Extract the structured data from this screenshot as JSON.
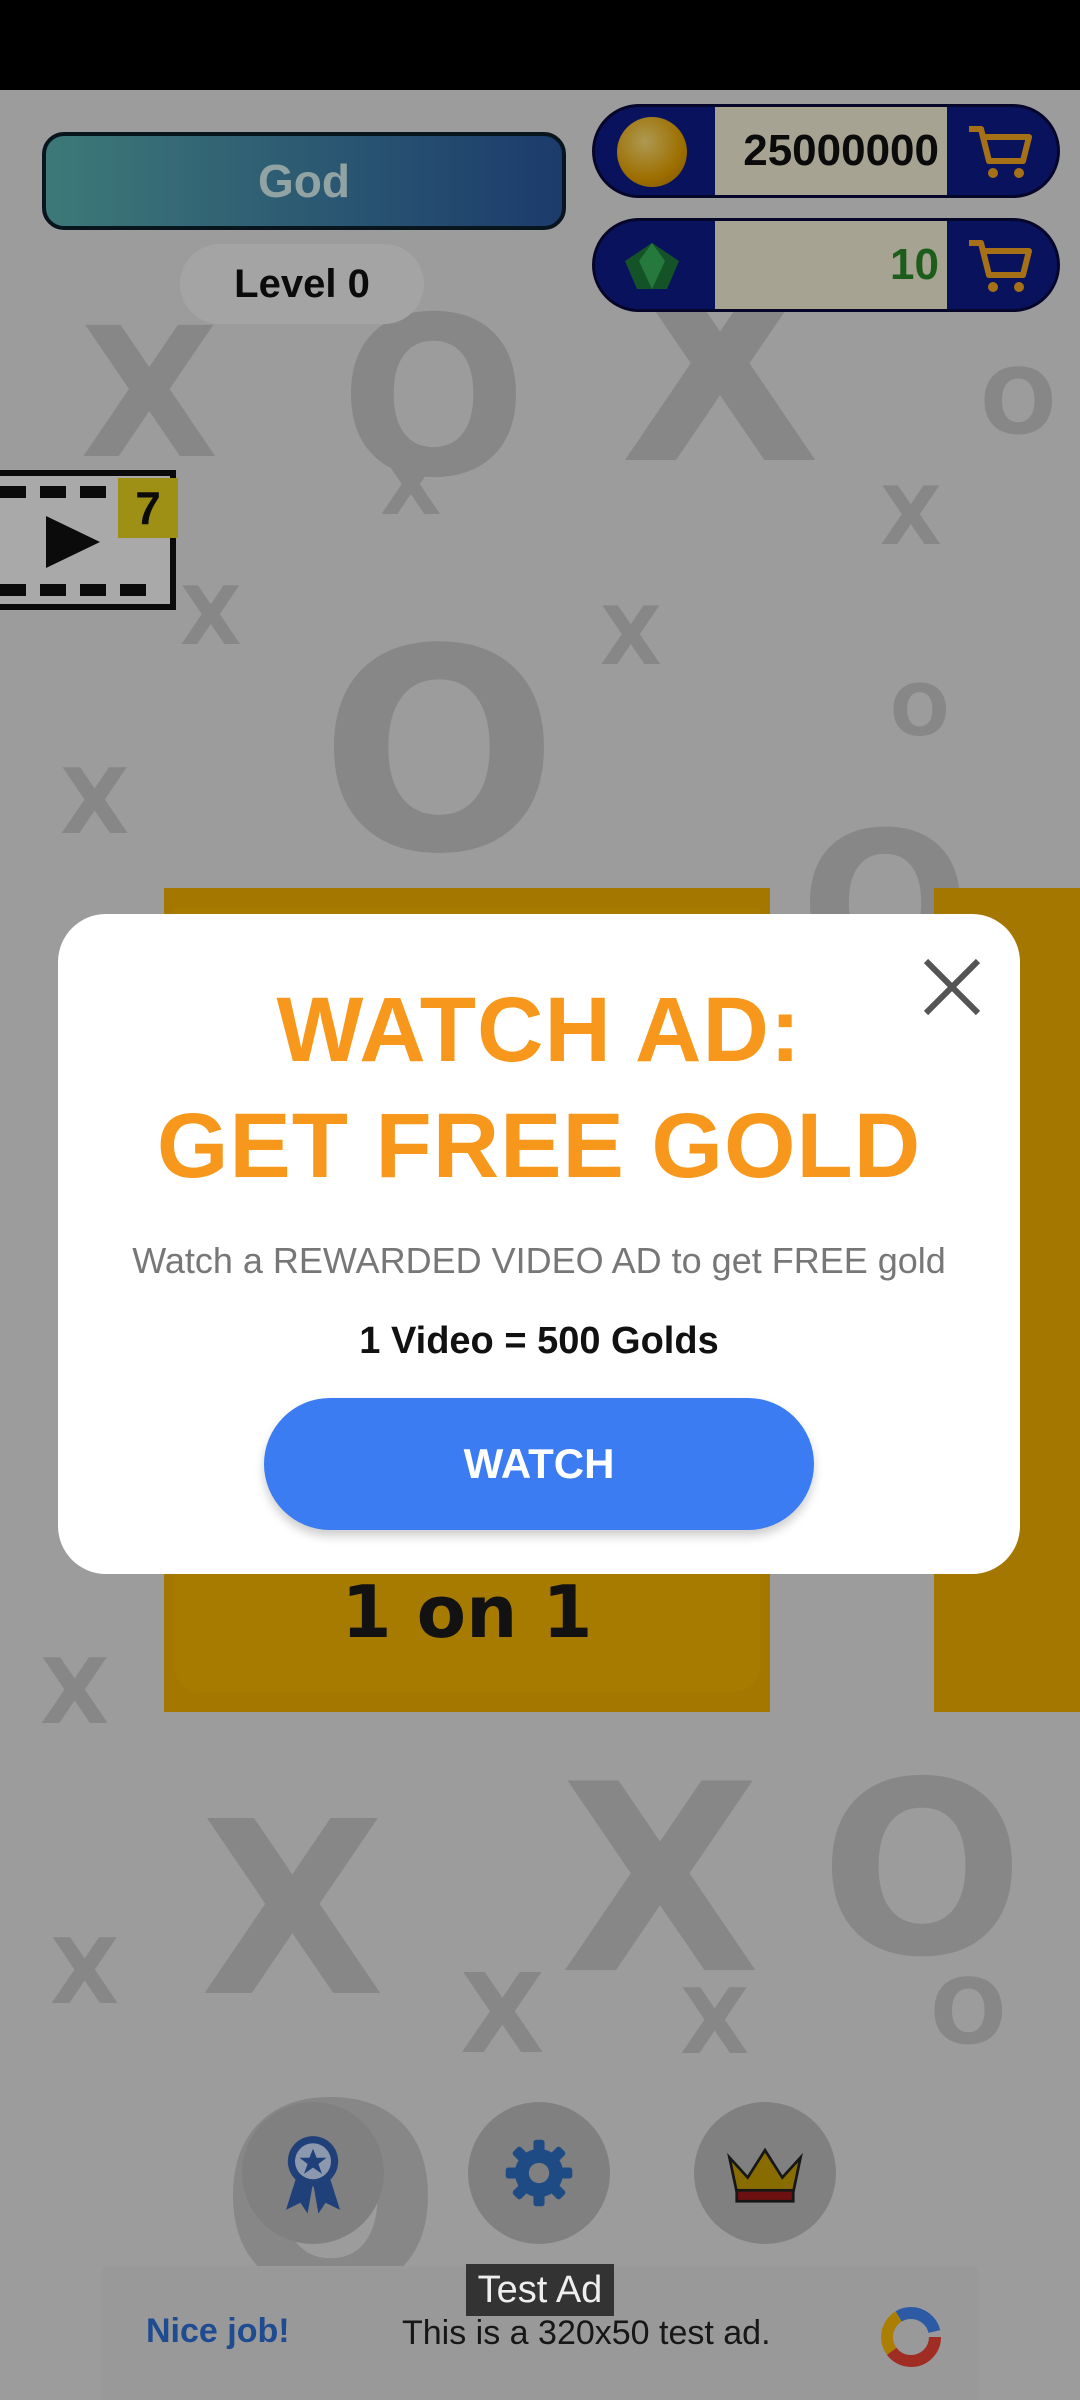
{
  "header": {
    "rank_label": "God",
    "level_label": "Level 0",
    "coins_value": "25000000",
    "gems_value": "10"
  },
  "video_reward": {
    "count": "7"
  },
  "game_mode": {
    "label": "1 on 1"
  },
  "dialog": {
    "title_line1": "WATCH AD:",
    "title_line2": "GET FREE GOLD",
    "description": "Watch a  REWARDED VIDEO AD to get FREE gold",
    "rate": "1 Video = 500 Golds",
    "watch_label": "WATCH"
  },
  "bottom_nav": {
    "icons": [
      "award-ribbon-icon",
      "gear-icon",
      "crown-icon"
    ]
  },
  "ad": {
    "tag": "Test Ad",
    "headline": "Nice job!",
    "body": "This is a 320x50 test ad."
  },
  "colors": {
    "accent_orange": "#f7971b",
    "watch_blue": "#3b7cf3",
    "currency_navy": "#0e1d8a",
    "card_yellow": "#f2b000"
  }
}
